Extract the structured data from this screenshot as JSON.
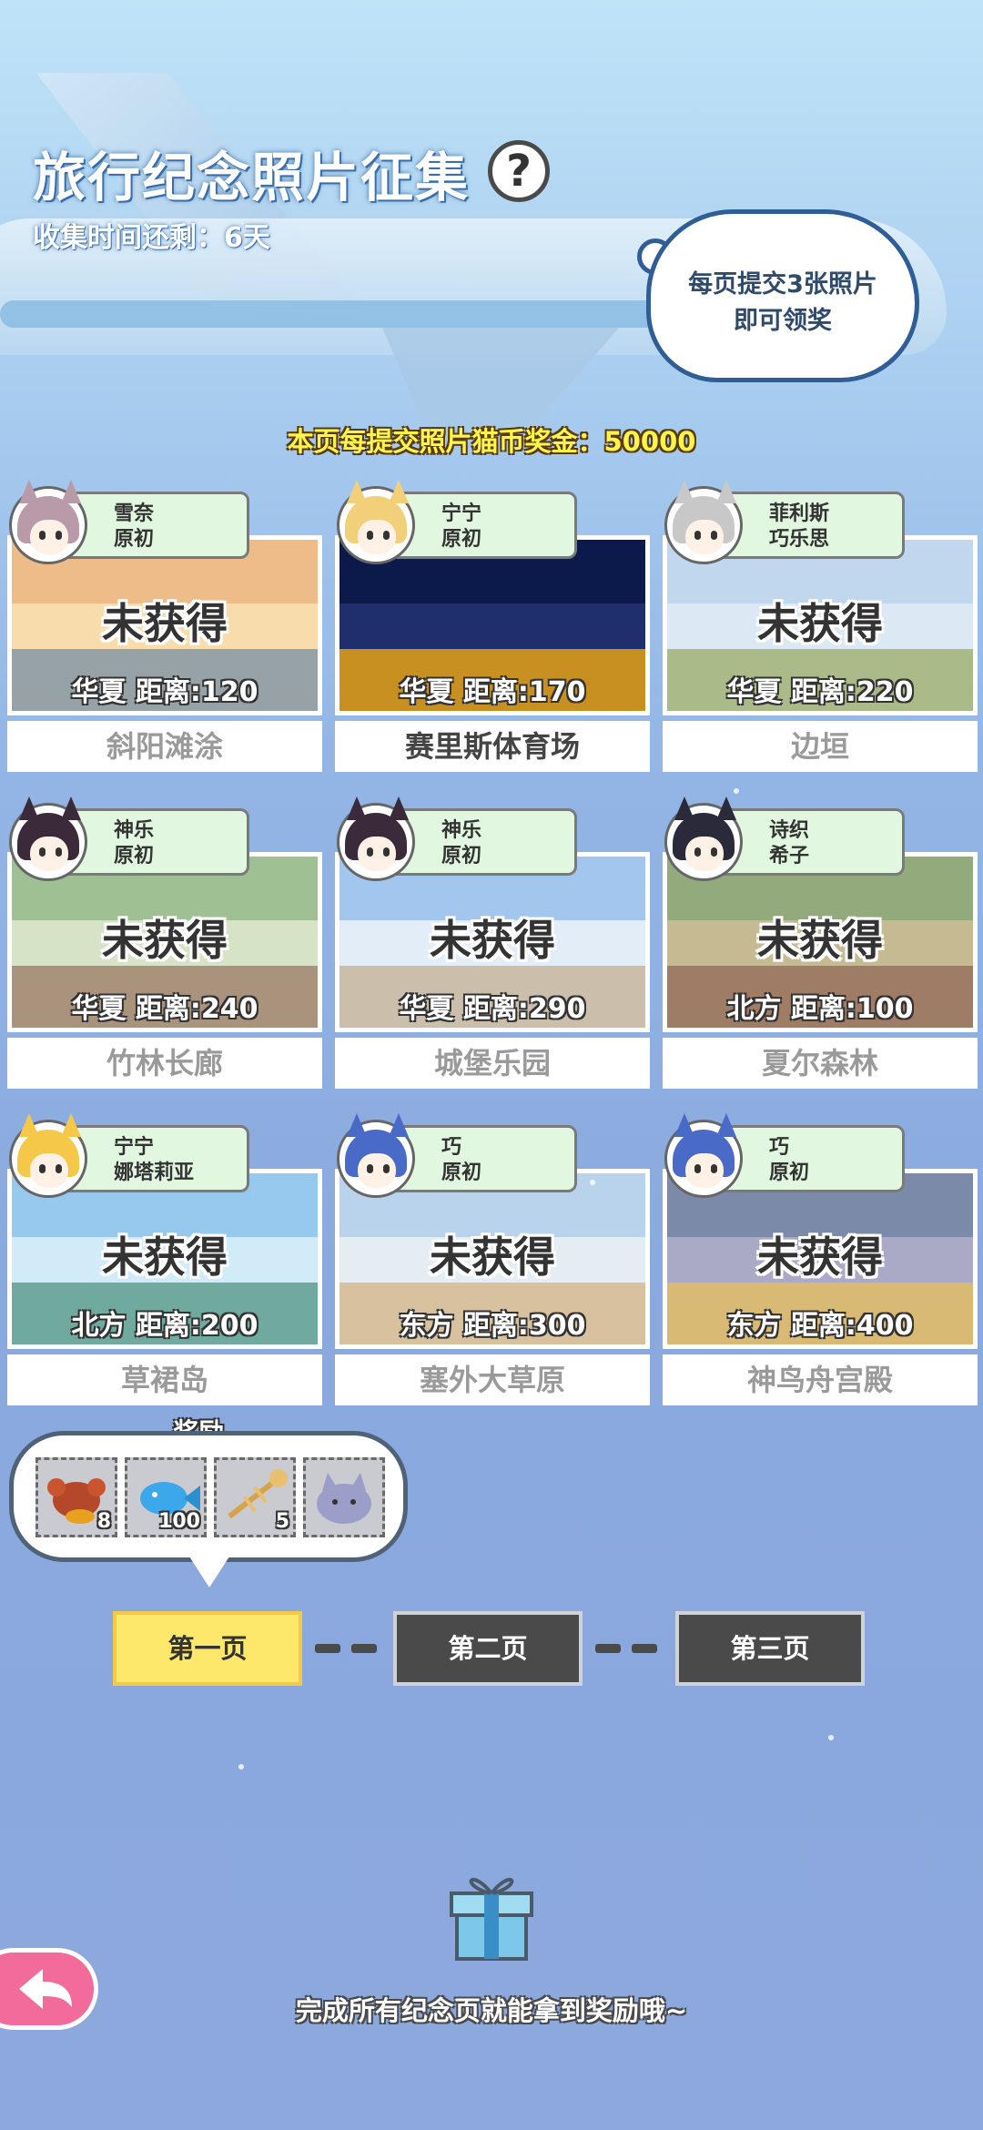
{
  "event": {
    "title": "旅行纪念照片征集",
    "countdown": "收集时间还剩：6天",
    "bubble_line1": "每页提交3张照片",
    "bubble_line2": "即可领奖",
    "bonus": "本页每提交照片猫币奖金：50000"
  },
  "photos": [
    {
      "characters": [
        "雪奈",
        "原初"
      ],
      "status": "未获得",
      "distance": "华夏  距离:120",
      "name": "斜阳滩涂",
      "unlocked": false,
      "scene": [
        "#e8a25a",
        "#f5cf8b",
        "#6f7f86"
      ]
    },
    {
      "characters": [
        "宁宁",
        "原初"
      ],
      "status": "",
      "distance": "华夏  距离:170",
      "name": "赛里斯体育场",
      "unlocked": true,
      "scene": [
        "#0b1a4a",
        "#1f2f6e",
        "#c79020"
      ]
    },
    {
      "characters": [
        "菲利斯",
        "巧乐思"
      ],
      "status": "未获得",
      "distance": "华夏  距离:220",
      "name": "边垣",
      "unlocked": false,
      "scene": [
        "#a8c8e8",
        "#cfe0ef",
        "#8aa05a"
      ]
    },
    {
      "characters": [
        "神乐",
        "原初"
      ],
      "status": "未获得",
      "distance": "华夏  距离:240",
      "name": "竹林长廊",
      "unlocked": false,
      "scene": [
        "#7aa86a",
        "#c8d8b0",
        "#8a6a4a"
      ]
    },
    {
      "characters": [
        "神乐",
        "原初"
      ],
      "status": "未获得",
      "distance": "华夏  距离:290",
      "name": "城堡乐园",
      "unlocked": false,
      "scene": [
        "#7fb0e6",
        "#d9e7f5",
        "#b7a58a"
      ]
    },
    {
      "characters": [
        "诗织",
        "希子"
      ],
      "status": "未获得",
      "distance": "北方  距离:100",
      "name": "夏尔森林",
      "unlocked": false,
      "scene": [
        "#6a8a4a",
        "#b0a06a",
        "#7a4a2a"
      ]
    },
    {
      "characters": [
        "宁宁",
        "娜塔莉亚"
      ],
      "status": "未获得",
      "distance": "北方  距离:200",
      "name": "草裙岛",
      "unlocked": false,
      "scene": [
        "#6fb3e6",
        "#bfe3f5",
        "#3a8a7a"
      ]
    },
    {
      "characters": [
        "巧",
        "原初"
      ],
      "status": "未获得",
      "distance": "东方  距离:300",
      "name": "塞外大草原",
      "unlocked": false,
      "scene": [
        "#9ec3e6",
        "#d9e6ee",
        "#c9a97a"
      ]
    },
    {
      "characters": [
        "巧",
        "原初"
      ],
      "status": "未获得",
      "distance": "东方  距离:400",
      "name": "神鸟舟宫殿",
      "unlocked": false,
      "scene": [
        "#4a5e8a",
        "#8a8ab0",
        "#c9a040"
      ]
    }
  ],
  "rewards": {
    "label": "奖励",
    "items": [
      {
        "icon": "lobster-icon",
        "count": "8"
      },
      {
        "icon": "blue-fish-icon",
        "count": "100"
      },
      {
        "icon": "fish-bone-icon",
        "count": "5"
      },
      {
        "icon": "cat-plush-icon",
        "count": ""
      }
    ]
  },
  "pages": [
    "第一页",
    "第二页",
    "第三页"
  ],
  "footer": "完成所有纪念页就能拿到奖励哦~"
}
